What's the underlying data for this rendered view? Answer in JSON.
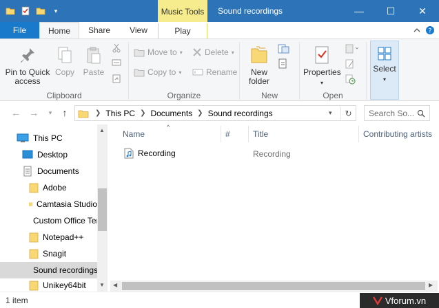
{
  "window": {
    "title": "Sound recordings",
    "context_tab_group": "Music Tools",
    "controls": {
      "minimize": "—",
      "maximize": "☐",
      "close": "✕"
    },
    "accent": "#2d73b8"
  },
  "ribbon_tabs": {
    "file": "File",
    "home": "Home",
    "share": "Share",
    "view": "View",
    "play": "Play"
  },
  "ribbon": {
    "clipboard": {
      "label": "Clipboard",
      "pin": "Pin to Quick access",
      "copy": "Copy",
      "paste": "Paste"
    },
    "organize": {
      "label": "Organize",
      "move_to": "Move to",
      "copy_to": "Copy to",
      "delete": "Delete",
      "rename": "Rename"
    },
    "new": {
      "label": "New",
      "new_folder": "New folder"
    },
    "open": {
      "label": "Open",
      "properties": "Properties"
    },
    "select": {
      "select": "Select"
    }
  },
  "address": {
    "crumbs": [
      "This PC",
      "Documents",
      "Sound recordings"
    ],
    "search_placeholder": "Search So..."
  },
  "nav": {
    "items": [
      {
        "label": "This PC",
        "icon": "computer-icon"
      },
      {
        "label": "Desktop",
        "icon": "desktop-icon"
      },
      {
        "label": "Documents",
        "icon": "documents-icon"
      },
      {
        "label": "Adobe",
        "icon": "folder-icon"
      },
      {
        "label": "Camtasia Studio",
        "icon": "folder-icon"
      },
      {
        "label": "Custom Office Templates",
        "icon": "folder-icon"
      },
      {
        "label": "Notepad++",
        "icon": "folder-icon"
      },
      {
        "label": "Snagit",
        "icon": "folder-icon"
      },
      {
        "label": "Sound recordings",
        "icon": "folder-icon"
      },
      {
        "label": "Unikey64bit",
        "icon": "folder-icon"
      }
    ]
  },
  "columns": {
    "name": "Name",
    "number": "#",
    "title": "Title",
    "artists": "Contributing artists"
  },
  "files": [
    {
      "name": "Recording",
      "title": "Recording",
      "icon": "audio-file-icon"
    }
  ],
  "status": {
    "count": "1 item"
  },
  "watermark": {
    "text": "Vforum.vn"
  }
}
